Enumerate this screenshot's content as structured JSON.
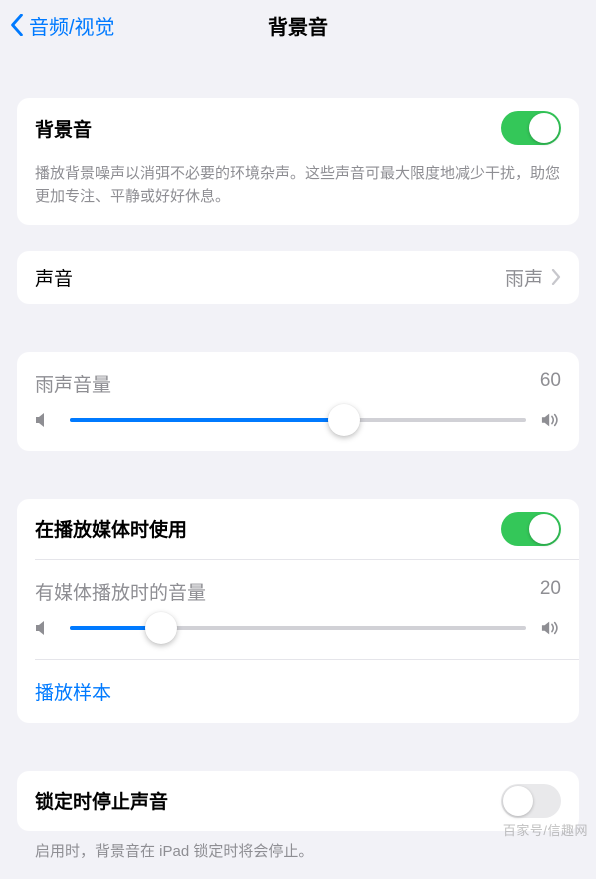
{
  "nav": {
    "back": "音频/视觉",
    "title": "背景音"
  },
  "main_toggle": {
    "label": "背景音",
    "on": true,
    "desc": "播放背景噪声以消弭不必要的环境杂声。这些声音可最大限度地减少干扰，助您更加专注、平静或好好休息。"
  },
  "sound_row": {
    "label": "声音",
    "value": "雨声"
  },
  "volume": {
    "label": "雨声音量",
    "value": "60",
    "percent": 60
  },
  "media": {
    "use_label": "在播放媒体时使用",
    "use_on": true,
    "vol_label": "有媒体播放时的音量",
    "vol_value": "20",
    "vol_percent": 20,
    "sample": "播放样本"
  },
  "lock": {
    "label": "锁定时停止声音",
    "on": false,
    "desc": "启用时，背景音在 iPad 锁定时将会停止。"
  },
  "watermark": "百家号/信趣网"
}
